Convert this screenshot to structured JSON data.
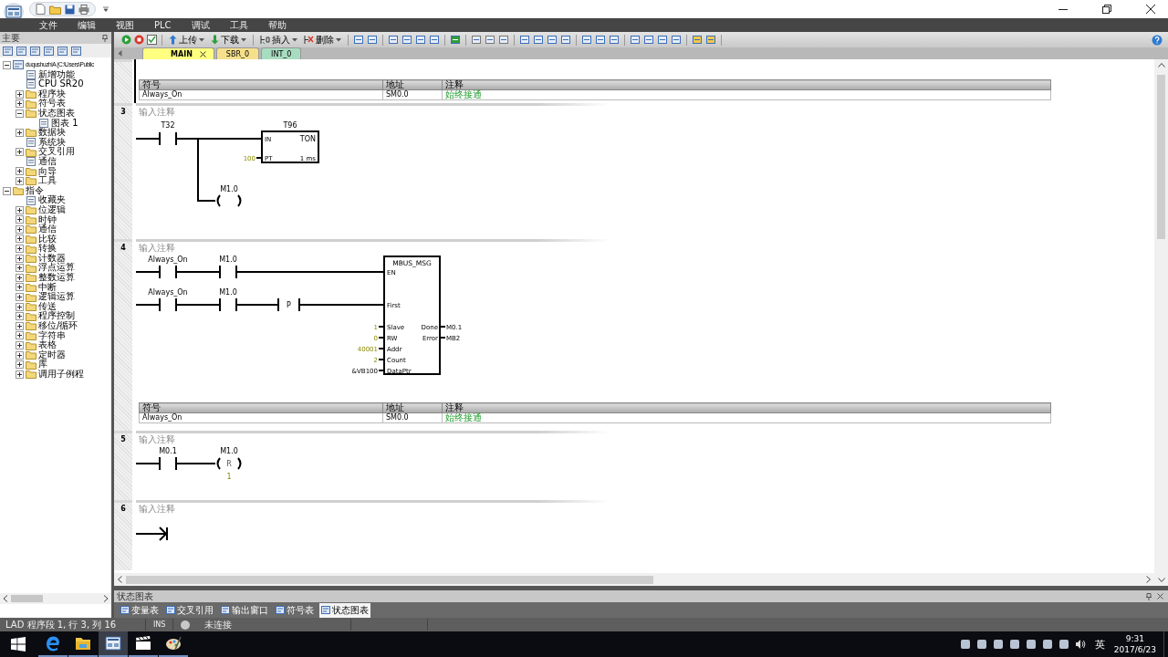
{
  "menu": [
    "文件",
    "编辑",
    "视图",
    "PLC",
    "调试",
    "工具",
    "帮助"
  ],
  "left_pane": {
    "title": "主要"
  },
  "tree": {
    "items": [
      {
        "label": "duqushuzhiA (C:\\Users\\Public",
        "kind": "project",
        "expanded": true,
        "children": [
          {
            "label": "新增功能",
            "kind": "item"
          },
          {
            "label": "CPU SR20",
            "kind": "item"
          },
          {
            "label": "程序块",
            "kind": "folder",
            "expanded": false
          },
          {
            "label": "符号表",
            "kind": "folder",
            "expanded": false
          },
          {
            "label": "状态图表",
            "kind": "folder",
            "expanded": true,
            "children": [
              {
                "label": "图表 1",
                "kind": "item"
              }
            ]
          },
          {
            "label": "数据块",
            "kind": "folder",
            "expanded": false
          },
          {
            "label": "系统块",
            "kind": "item"
          },
          {
            "label": "交叉引用",
            "kind": "folder",
            "expanded": false
          },
          {
            "label": "通信",
            "kind": "item"
          },
          {
            "label": "向导",
            "kind": "folder",
            "expanded": false
          },
          {
            "label": "工具",
            "kind": "folder",
            "expanded": false
          }
        ]
      },
      {
        "label": "指令",
        "kind": "folder",
        "expanded": true,
        "children": [
          {
            "label": "收藏夹",
            "kind": "item"
          },
          {
            "label": "位逻辑",
            "kind": "folder",
            "expanded": false
          },
          {
            "label": "时钟",
            "kind": "folder",
            "expanded": false
          },
          {
            "label": "通信",
            "kind": "folder",
            "expanded": false
          },
          {
            "label": "比较",
            "kind": "folder",
            "expanded": false
          },
          {
            "label": "转换",
            "kind": "folder",
            "expanded": false
          },
          {
            "label": "计数器",
            "kind": "folder",
            "expanded": false
          },
          {
            "label": "浮点运算",
            "kind": "folder",
            "expanded": false
          },
          {
            "label": "整数运算",
            "kind": "folder",
            "expanded": false
          },
          {
            "label": "中断",
            "kind": "folder",
            "expanded": false
          },
          {
            "label": "逻辑运算",
            "kind": "folder",
            "expanded": false
          },
          {
            "label": "传送",
            "kind": "folder",
            "expanded": false
          },
          {
            "label": "程序控制",
            "kind": "folder",
            "expanded": false
          },
          {
            "label": "移位/循环",
            "kind": "folder",
            "expanded": false
          },
          {
            "label": "字符串",
            "kind": "folder",
            "expanded": false
          },
          {
            "label": "表格",
            "kind": "folder",
            "expanded": false
          },
          {
            "label": "定时器",
            "kind": "folder",
            "expanded": false
          },
          {
            "label": "库",
            "kind": "folder",
            "expanded": false
          },
          {
            "label": "调用子例程",
            "kind": "folder",
            "expanded": false
          }
        ]
      }
    ]
  },
  "toolbar": {
    "buttons": [
      {
        "label": "上传"
      },
      {
        "label": "下载"
      },
      {
        "label": "插入"
      },
      {
        "label": "删除"
      }
    ]
  },
  "tabs": [
    {
      "label": "MAIN",
      "selected": true,
      "color": "#ffff80"
    },
    {
      "label": "SBR_0",
      "selected": false,
      "color": "#f6e08c"
    },
    {
      "label": "INT_0",
      "selected": false,
      "color": "#a8dcc0"
    }
  ],
  "networks": [
    {
      "kind": "symbols_only",
      "symbols": {
        "columns": [
          "符号",
          "地址",
          "注释"
        ],
        "rows": [
          {
            "symbol": "Always_On",
            "address": "SM0.0",
            "comment": "始终接通"
          }
        ]
      }
    },
    {
      "kind": "timer",
      "number": "3",
      "comment": "输入注释",
      "contact": "T32",
      "timer": {
        "name": "T96",
        "type": "TON",
        "in_pin": "IN",
        "pt_pin": "PT",
        "pt_value": "100",
        "resolution": "1 ms"
      },
      "coil": "M1.0"
    },
    {
      "kind": "mbus",
      "number": "4",
      "comment": "输入注释",
      "rungs": [
        {
          "contacts": [
            "Always_On",
            "M1.0"
          ]
        },
        {
          "contacts": [
            "Always_On",
            "M1.0"
          ],
          "edge": "P"
        }
      ],
      "block": {
        "name": "MBUS_MSG",
        "enable_pins": [
          "EN",
          "First"
        ],
        "inputs": [
          {
            "pin": "Slave",
            "value": "1",
            "constant": true
          },
          {
            "pin": "RW",
            "value": "0",
            "constant": true
          },
          {
            "pin": "Addr",
            "value": "40001",
            "constant": true
          },
          {
            "pin": "Count",
            "value": "2",
            "constant": true
          },
          {
            "pin": "DataPtr",
            "value": "&VB100",
            "constant": false
          }
        ],
        "outputs": [
          {
            "pin": "Done",
            "value": "M0.1"
          },
          {
            "pin": "Error",
            "value": "MB2"
          }
        ]
      },
      "symbols": {
        "columns": [
          "符号",
          "地址",
          "注释"
        ],
        "rows": [
          {
            "symbol": "Always_On",
            "address": "SM0.0",
            "comment": "始终接通"
          }
        ]
      }
    },
    {
      "kind": "reset",
      "number": "5",
      "comment": "输入注释",
      "contact": "M0.1",
      "coil": "M1.0",
      "coil_type": "R",
      "count": "1"
    },
    {
      "kind": "end",
      "number": "6",
      "comment": "输入注释"
    }
  ],
  "bottom_panel": {
    "title": "状态图表",
    "tabs": [
      {
        "label": "变量表",
        "selected": false
      },
      {
        "label": "交叉引用",
        "selected": false
      },
      {
        "label": "输出窗口",
        "selected": false
      },
      {
        "label": "符号表",
        "selected": false
      },
      {
        "label": "状态图表",
        "selected": true
      }
    ]
  },
  "status_bar": {
    "position": "LAD 程序段 1, 行 3, 列 16",
    "mode": "INS",
    "connection": "未连接"
  },
  "taskbar": {
    "apps": [
      {
        "selected": false
      },
      {
        "selected": false
      },
      {
        "selected": true
      },
      {
        "selected": false
      },
      {
        "selected": false
      }
    ],
    "language": "英",
    "time": "9:31",
    "date": "2017/6/23"
  }
}
